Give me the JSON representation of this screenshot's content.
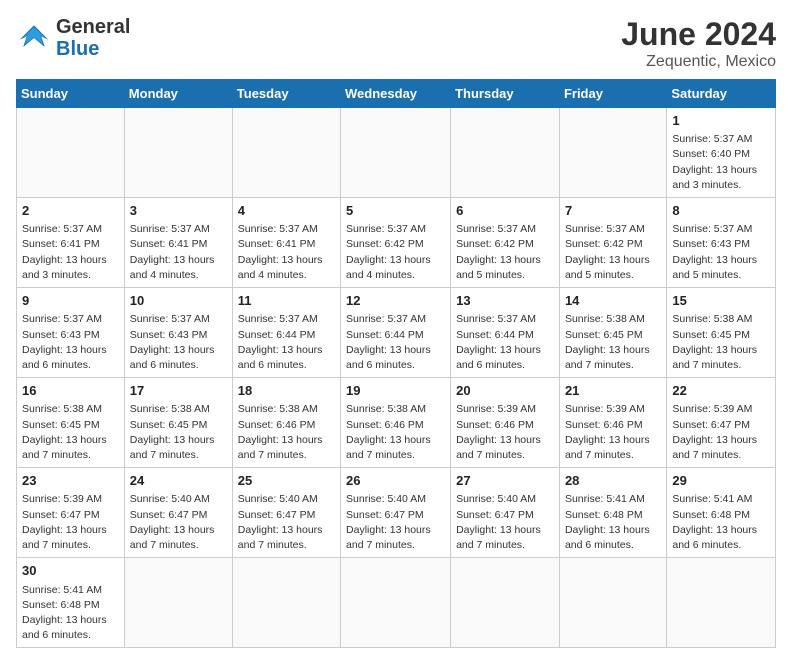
{
  "logo": {
    "text_general": "General",
    "text_blue": "Blue"
  },
  "title": "June 2024",
  "subtitle": "Zequentic, Mexico",
  "days_of_week": [
    "Sunday",
    "Monday",
    "Tuesday",
    "Wednesday",
    "Thursday",
    "Friday",
    "Saturday"
  ],
  "weeks": [
    [
      {
        "day": "",
        "info": ""
      },
      {
        "day": "",
        "info": ""
      },
      {
        "day": "",
        "info": ""
      },
      {
        "day": "",
        "info": ""
      },
      {
        "day": "",
        "info": ""
      },
      {
        "day": "",
        "info": ""
      },
      {
        "day": "1",
        "info": "Sunrise: 5:37 AM\nSunset: 6:40 PM\nDaylight: 13 hours and 3 minutes."
      }
    ],
    [
      {
        "day": "2",
        "info": "Sunrise: 5:37 AM\nSunset: 6:41 PM\nDaylight: 13 hours and 3 minutes."
      },
      {
        "day": "3",
        "info": "Sunrise: 5:37 AM\nSunset: 6:41 PM\nDaylight: 13 hours and 4 minutes."
      },
      {
        "day": "4",
        "info": "Sunrise: 5:37 AM\nSunset: 6:41 PM\nDaylight: 13 hours and 4 minutes."
      },
      {
        "day": "5",
        "info": "Sunrise: 5:37 AM\nSunset: 6:42 PM\nDaylight: 13 hours and 4 minutes."
      },
      {
        "day": "6",
        "info": "Sunrise: 5:37 AM\nSunset: 6:42 PM\nDaylight: 13 hours and 5 minutes."
      },
      {
        "day": "7",
        "info": "Sunrise: 5:37 AM\nSunset: 6:42 PM\nDaylight: 13 hours and 5 minutes."
      },
      {
        "day": "8",
        "info": "Sunrise: 5:37 AM\nSunset: 6:43 PM\nDaylight: 13 hours and 5 minutes."
      }
    ],
    [
      {
        "day": "9",
        "info": "Sunrise: 5:37 AM\nSunset: 6:43 PM\nDaylight: 13 hours and 6 minutes."
      },
      {
        "day": "10",
        "info": "Sunrise: 5:37 AM\nSunset: 6:43 PM\nDaylight: 13 hours and 6 minutes."
      },
      {
        "day": "11",
        "info": "Sunrise: 5:37 AM\nSunset: 6:44 PM\nDaylight: 13 hours and 6 minutes."
      },
      {
        "day": "12",
        "info": "Sunrise: 5:37 AM\nSunset: 6:44 PM\nDaylight: 13 hours and 6 minutes."
      },
      {
        "day": "13",
        "info": "Sunrise: 5:37 AM\nSunset: 6:44 PM\nDaylight: 13 hours and 6 minutes."
      },
      {
        "day": "14",
        "info": "Sunrise: 5:38 AM\nSunset: 6:45 PM\nDaylight: 13 hours and 7 minutes."
      },
      {
        "day": "15",
        "info": "Sunrise: 5:38 AM\nSunset: 6:45 PM\nDaylight: 13 hours and 7 minutes."
      }
    ],
    [
      {
        "day": "16",
        "info": "Sunrise: 5:38 AM\nSunset: 6:45 PM\nDaylight: 13 hours and 7 minutes."
      },
      {
        "day": "17",
        "info": "Sunrise: 5:38 AM\nSunset: 6:45 PM\nDaylight: 13 hours and 7 minutes."
      },
      {
        "day": "18",
        "info": "Sunrise: 5:38 AM\nSunset: 6:46 PM\nDaylight: 13 hours and 7 minutes."
      },
      {
        "day": "19",
        "info": "Sunrise: 5:38 AM\nSunset: 6:46 PM\nDaylight: 13 hours and 7 minutes."
      },
      {
        "day": "20",
        "info": "Sunrise: 5:39 AM\nSunset: 6:46 PM\nDaylight: 13 hours and 7 minutes."
      },
      {
        "day": "21",
        "info": "Sunrise: 5:39 AM\nSunset: 6:46 PM\nDaylight: 13 hours and 7 minutes."
      },
      {
        "day": "22",
        "info": "Sunrise: 5:39 AM\nSunset: 6:47 PM\nDaylight: 13 hours and 7 minutes."
      }
    ],
    [
      {
        "day": "23",
        "info": "Sunrise: 5:39 AM\nSunset: 6:47 PM\nDaylight: 13 hours and 7 minutes."
      },
      {
        "day": "24",
        "info": "Sunrise: 5:40 AM\nSunset: 6:47 PM\nDaylight: 13 hours and 7 minutes."
      },
      {
        "day": "25",
        "info": "Sunrise: 5:40 AM\nSunset: 6:47 PM\nDaylight: 13 hours and 7 minutes."
      },
      {
        "day": "26",
        "info": "Sunrise: 5:40 AM\nSunset: 6:47 PM\nDaylight: 13 hours and 7 minutes."
      },
      {
        "day": "27",
        "info": "Sunrise: 5:40 AM\nSunset: 6:47 PM\nDaylight: 13 hours and 7 minutes."
      },
      {
        "day": "28",
        "info": "Sunrise: 5:41 AM\nSunset: 6:48 PM\nDaylight: 13 hours and 6 minutes."
      },
      {
        "day": "29",
        "info": "Sunrise: 5:41 AM\nSunset: 6:48 PM\nDaylight: 13 hours and 6 minutes."
      }
    ],
    [
      {
        "day": "30",
        "info": "Sunrise: 5:41 AM\nSunset: 6:48 PM\nDaylight: 13 hours and 6 minutes."
      },
      {
        "day": "",
        "info": ""
      },
      {
        "day": "",
        "info": ""
      },
      {
        "day": "",
        "info": ""
      },
      {
        "day": "",
        "info": ""
      },
      {
        "day": "",
        "info": ""
      },
      {
        "day": "",
        "info": ""
      }
    ]
  ]
}
